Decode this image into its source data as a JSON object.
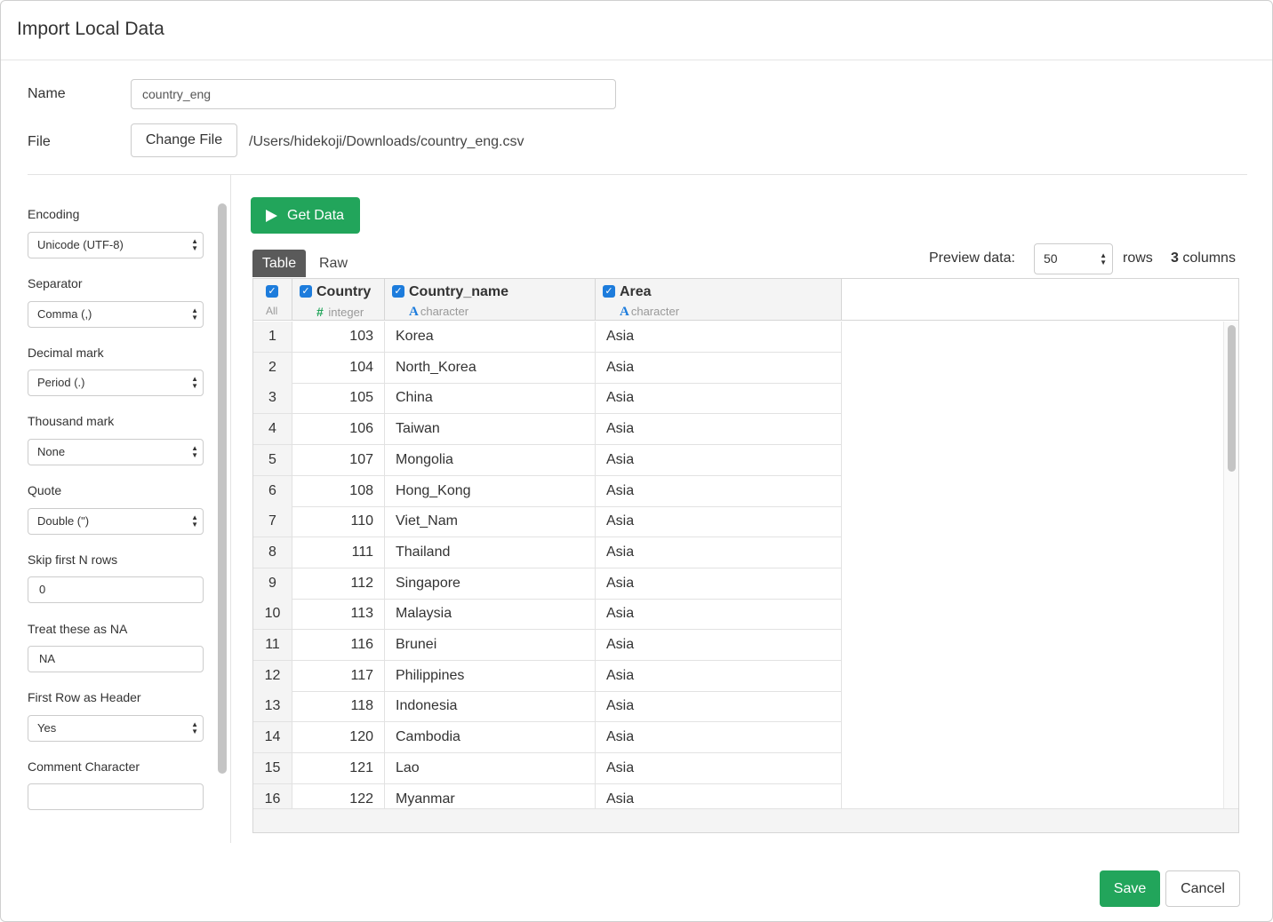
{
  "dialog": {
    "title": "Import Local Data"
  },
  "form": {
    "name_label": "Name",
    "name_value": "country_eng",
    "file_label": "File",
    "change_file_label": "Change File",
    "file_path": "/Users/hidekoji/Downloads/country_eng.csv"
  },
  "settings": {
    "encoding": {
      "label": "Encoding",
      "value": "Unicode (UTF-8)"
    },
    "separator": {
      "label": "Separator",
      "value": "Comma (,)"
    },
    "decimal": {
      "label": "Decimal mark",
      "value": "Period (.)"
    },
    "thousand": {
      "label": "Thousand mark",
      "value": "None"
    },
    "quote": {
      "label": "Quote",
      "value": "Double (\")"
    },
    "skip": {
      "label": "Skip first N rows",
      "value": "0"
    },
    "na": {
      "label": "Treat these as NA",
      "value": "NA"
    },
    "header": {
      "label": "First Row as Header",
      "value": "Yes"
    },
    "comment": {
      "label": "Comment Character",
      "value": ""
    }
  },
  "actions": {
    "get_data": "Get Data",
    "save": "Save",
    "cancel": "Cancel"
  },
  "view_tabs": {
    "table": "Table",
    "raw": "Raw"
  },
  "preview": {
    "label": "Preview data:",
    "rows_value": "50",
    "rows_unit": "rows",
    "columns_count": "3",
    "columns_unit": "columns"
  },
  "table": {
    "all_label": "All",
    "columns": [
      {
        "name": "Country",
        "type": "integer",
        "type_icon": "#"
      },
      {
        "name": "Country_name",
        "type": "character",
        "type_icon": "A"
      },
      {
        "name": "Area",
        "type": "character",
        "type_icon": "A"
      }
    ],
    "rows": [
      [
        "1",
        "103",
        "Korea",
        "Asia"
      ],
      [
        "2",
        "104",
        "North_Korea",
        "Asia"
      ],
      [
        "3",
        "105",
        "China",
        "Asia"
      ],
      [
        "4",
        "106",
        "Taiwan",
        "Asia"
      ],
      [
        "5",
        "107",
        "Mongolia",
        "Asia"
      ],
      [
        "6",
        "108",
        "Hong_Kong",
        "Asia"
      ],
      [
        "7",
        "110",
        "Viet_Nam",
        "Asia"
      ],
      [
        "8",
        "111",
        "Thailand",
        "Asia"
      ],
      [
        "9",
        "112",
        "Singapore",
        "Asia"
      ],
      [
        "10",
        "113",
        "Malaysia",
        "Asia"
      ],
      [
        "11",
        "116",
        "Brunei",
        "Asia"
      ],
      [
        "12",
        "117",
        "Philippines",
        "Asia"
      ],
      [
        "13",
        "118",
        "Indonesia",
        "Asia"
      ],
      [
        "14",
        "120",
        "Cambodia",
        "Asia"
      ],
      [
        "15",
        "121",
        "Lao",
        "Asia"
      ],
      [
        "16",
        "122",
        "Myanmar",
        "Asia"
      ]
    ]
  },
  "colors": {
    "accent_green": "#22a55b",
    "checkbox_blue": "#1d7cdc"
  }
}
